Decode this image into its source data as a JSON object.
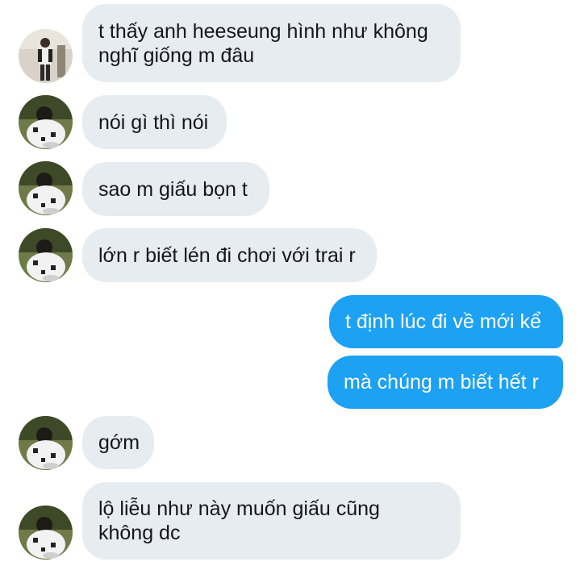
{
  "messages": [
    {
      "side": "in",
      "text": "t thấy anh heeseung hình như không\nnghĩ giống m đâu",
      "avatar": "avatar-portrait-standing"
    },
    {
      "side": "in",
      "text": "nói gì thì nói",
      "avatar": "avatar-portrait-sitting"
    },
    {
      "side": "in",
      "text": "sao m giấu bọn t",
      "avatar": "avatar-portrait-sitting"
    },
    {
      "side": "in",
      "text": "lớn r biết lén đi chơi với trai r",
      "avatar": "avatar-portrait-sitting"
    },
    {
      "side": "out",
      "text": "t định lúc đi về mới kể"
    },
    {
      "side": "out",
      "text": "mà chúng m biết hết r"
    },
    {
      "side": "in",
      "text": "gớm",
      "avatar": "avatar-portrait-sitting"
    },
    {
      "side": "in",
      "text": "lộ liễu như này muốn giấu cũng\nkhông dc",
      "avatar": "avatar-portrait-sitting"
    }
  ],
  "colors": {
    "incoming_bubble": "#e6ecf0",
    "outgoing_bubble": "#1da1f2",
    "incoming_text": "#14171a",
    "outgoing_text": "#ffffff"
  }
}
